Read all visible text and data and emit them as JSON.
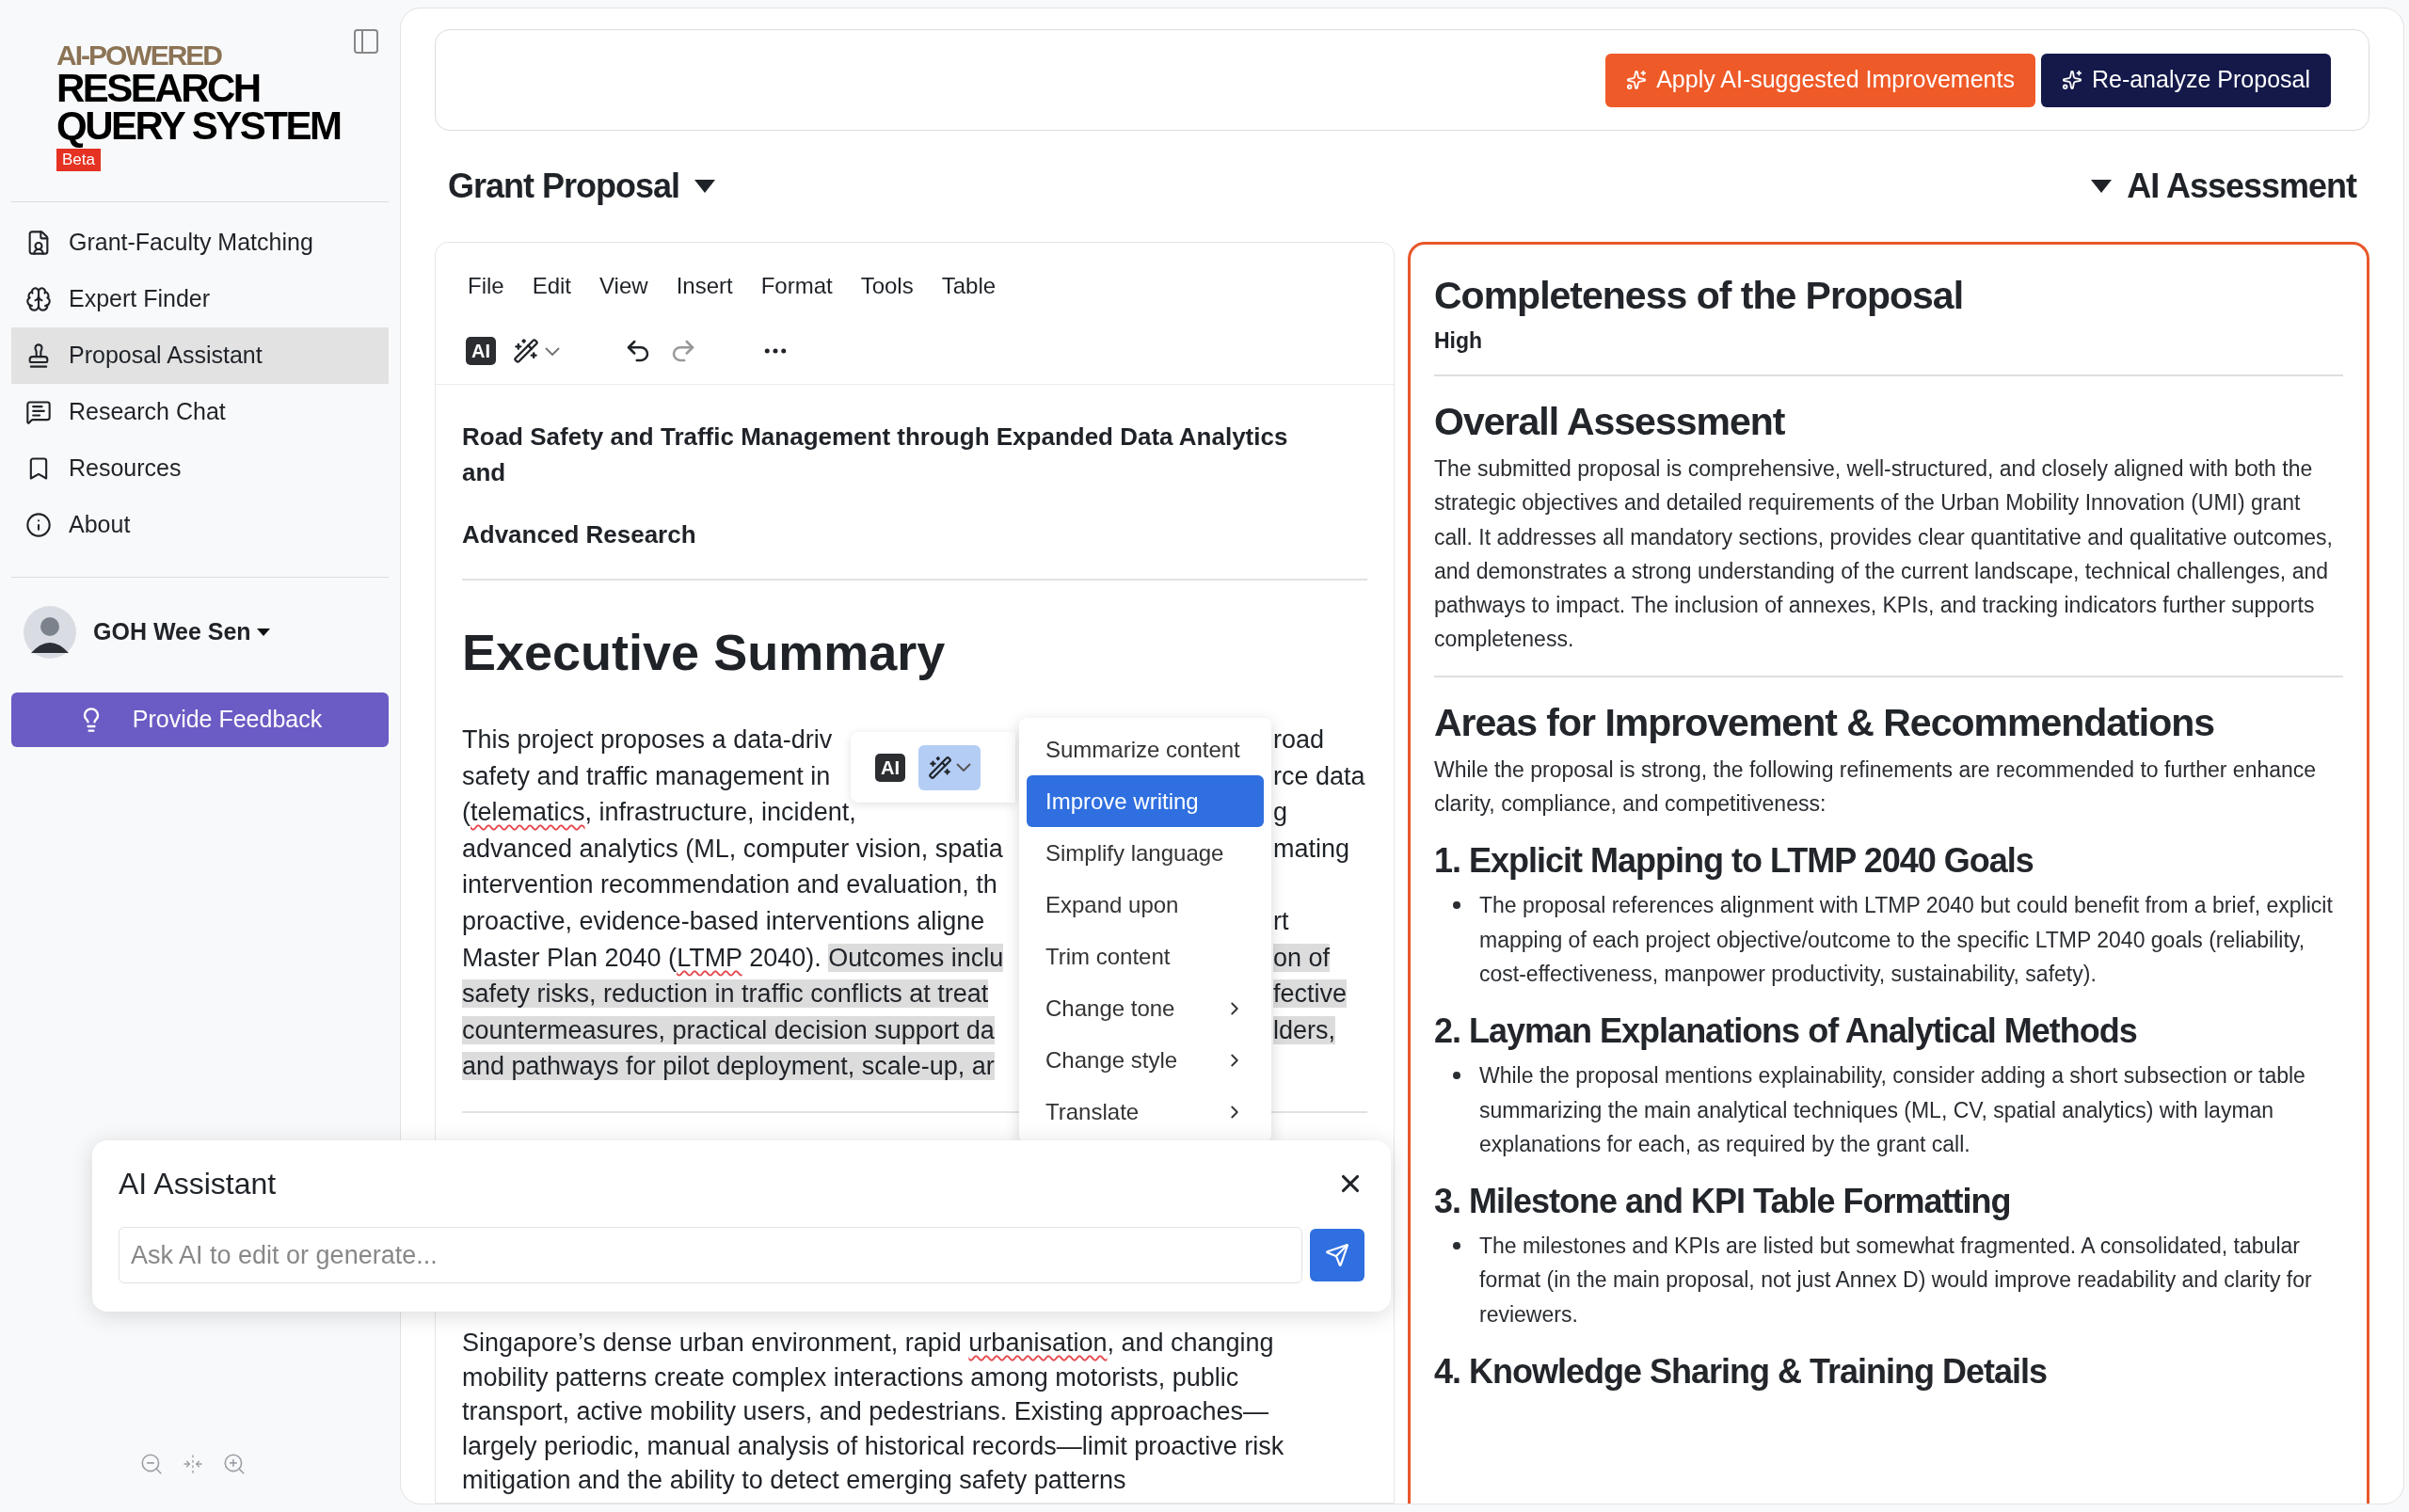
{
  "sidebar": {
    "logo": {
      "tagline": "AI-POWERED",
      "title_lines": [
        "RESEARCH",
        "QUERY SYSTEM"
      ],
      "badge": "Beta"
    },
    "items": [
      {
        "label": "Grant-Faculty Matching",
        "selected": false
      },
      {
        "label": "Expert Finder",
        "selected": false
      },
      {
        "label": "Proposal Assistant",
        "selected": true
      },
      {
        "label": "Research Chat",
        "selected": false
      },
      {
        "label": "Resources",
        "selected": false
      },
      {
        "label": "About",
        "selected": false
      }
    ],
    "user": {
      "name": "GOH Wee Sen"
    },
    "feedback_button": "Provide Feedback"
  },
  "top_bar": {
    "buttons": [
      {
        "label": "Apply AI-suggested Improvements",
        "kind": "accent"
      },
      {
        "label": "Re-analyze Proposal",
        "kind": "dark"
      }
    ]
  },
  "editor": {
    "title": "Grant Proposal",
    "menu": [
      "File",
      "Edit",
      "View",
      "Insert",
      "Format",
      "Tools",
      "Table"
    ],
    "toolbar": {
      "ai_label": "AI"
    },
    "document": {
      "title_paragraphs": [
        "Road Safety and Traffic Management through Expanded Data Analytics and",
        "Advanced Research"
      ],
      "heading": "Executive Summary",
      "summary_lines": [
        {
          "left": [
            {
              "text": "This project proposes a data-driv"
            }
          ],
          "right": [
            {
              "text": "road"
            }
          ]
        },
        {
          "left": [
            {
              "text": "safety and traffic management in"
            }
          ],
          "right": [
            {
              "text": "rce data"
            }
          ]
        },
        {
          "left": [
            {
              "text": "("
            },
            {
              "text": "telematics",
              "misspelled": true
            },
            {
              "text": ", infrastructure, incident,"
            }
          ],
          "right": [
            {
              "text": "g"
            }
          ]
        },
        {
          "left": [
            {
              "text": "advanced analytics (ML, computer vision, spatia"
            }
          ],
          "right": [
            {
              "text": "mating"
            }
          ]
        },
        {
          "left": [
            {
              "text": "intervention recommendation and evaluation, th"
            }
          ]
        },
        {
          "left": [
            {
              "text": "proactive, evidence-based interventions aligne"
            }
          ],
          "right": [
            {
              "text": "rt"
            }
          ]
        },
        {
          "left": [
            {
              "text": "Master Plan 2040 ("
            },
            {
              "text": "LTMP",
              "misspelled": true
            },
            {
              "text": " 2040). "
            },
            {
              "text": "Outcomes inclu",
              "highlighted": true
            }
          ],
          "right": [
            {
              "text": "on of",
              "highlighted": true
            }
          ]
        },
        {
          "left": [
            {
              "text": "safety risks, reduction in traffic conflicts at treat",
              "highlighted": true
            }
          ],
          "right": [
            {
              "text": "fective",
              "highlighted": true
            }
          ]
        },
        {
          "left": [
            {
              "text": "countermeasures, practical decision support da",
              "highlighted": true
            }
          ],
          "right": [
            {
              "text": "lders,",
              "highlighted": true
            }
          ]
        },
        {
          "left": [
            {
              "text": "and pathways for pilot deployment, scale-up, ar",
              "highlighted": true
            }
          ]
        }
      ],
      "context_lines": [
        [
          {
            "text": "Singapore’s dense urban environment, rapid "
          },
          {
            "text": "urbanisation",
            "misspelled": true
          },
          {
            "text": ", and changing"
          }
        ],
        [
          {
            "text": "mobility patterns create complex interactions among motorists, public"
          }
        ],
        [
          {
            "text": "transport, active mobility users, and pedestrians. Existing approaches—"
          }
        ],
        [
          {
            "text": "largely periodic, manual analysis of historical records—limit proactive risk"
          }
        ],
        [
          {
            "text": "mitigation and the ability to detect emerging safety patterns"
          }
        ]
      ]
    },
    "selection_toolbar": {
      "ai_label": "AI",
      "wand_active": true
    },
    "selection_menu": [
      {
        "label": "Summarize content",
        "selected": false,
        "submenu": false
      },
      {
        "label": "Improve writing",
        "selected": true,
        "submenu": false
      },
      {
        "label": "Simplify language",
        "selected": false,
        "submenu": false
      },
      {
        "label": "Expand upon",
        "selected": false,
        "submenu": false
      },
      {
        "label": "Trim content",
        "selected": false,
        "submenu": false
      },
      {
        "label": "Change tone",
        "selected": false,
        "submenu": true
      },
      {
        "label": "Change style",
        "selected": false,
        "submenu": true
      },
      {
        "label": "Translate",
        "selected": false,
        "submenu": true
      }
    ]
  },
  "ai_assistant": {
    "title": "AI Assistant",
    "placeholder": "Ask AI to edit or generate..."
  },
  "assessment": {
    "title": "AI Assessment",
    "sections": [
      {
        "kind": "rating",
        "title": "Completeness of the Proposal",
        "text": "High",
        "divider": true
      },
      {
        "kind": "paragraph",
        "title": "Overall Assessment",
        "text": "The submitted proposal is comprehensive, well-structured, and closely aligned with both the strategic objectives and detailed requirements of the Urban Mobility Innovation (UMI) grant call. It addresses all mandatory sections, provides clear quantitative and qualitative outcomes, and demonstrates a strong understanding of the current landscape, technical challenges, and pathways to impact. The inclusion of annexes, KPIs, and tracking indicators further supports completeness.",
        "divider": true
      },
      {
        "kind": "paragraph",
        "title": "Areas for Improvement & Recommendations",
        "text": "While the proposal is strong, the following refinements are recommended to further enhance clarity, compliance, and competitiveness:",
        "divider": false
      },
      {
        "kind": "item",
        "title": "1. Explicit Mapping to LTMP 2040 Goals",
        "bullets": [
          "The proposal references alignment with LTMP 2040 but could benefit from a brief, explicit mapping of each project objective/outcome to the specific LTMP 2040 goals (reliability, cost-effectiveness, manpower productivity, sustainability, safety)."
        ],
        "divider": false
      },
      {
        "kind": "item",
        "title": "2. Layman Explanations of Analytical Methods",
        "bullets": [
          "While the proposal mentions explainability, consider adding a short subsection or table summarizing the main analytical techniques (ML, CV, spatial analytics) with layman explanations for each, as required by the grant call."
        ],
        "divider": false
      },
      {
        "kind": "item",
        "title": "3. Milestone and KPI Table Formatting",
        "bullets": [
          "The milestones and KPIs are listed but somewhat fragmented. A consolidated, tabular format (in the main proposal, not just Annex D) would improve readability and clarity for reviewers."
        ],
        "divider": false
      },
      {
        "kind": "item",
        "title": "4. Knowledge Sharing & Training Details",
        "divider": false
      }
    ]
  }
}
